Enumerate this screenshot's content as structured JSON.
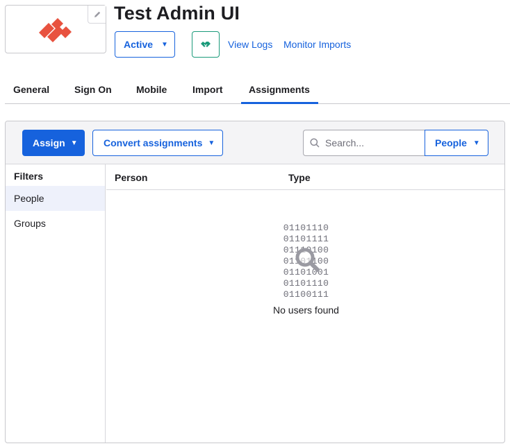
{
  "header": {
    "title": "Test Admin UI",
    "logo_icon": "paloalto-logo-icon",
    "edit_icon": "pencil-icon",
    "status_label": "Active",
    "status_caret": "▼",
    "handshake_icon": "handshake-icon",
    "links": [
      "View Logs",
      "Monitor Imports"
    ]
  },
  "tabs": [
    {
      "label": "General"
    },
    {
      "label": "Sign On"
    },
    {
      "label": "Mobile"
    },
    {
      "label": "Import"
    },
    {
      "label": "Assignments",
      "active": true
    }
  ],
  "toolbar": {
    "assign_label": "Assign",
    "convert_label": "Convert assignments",
    "caret": "▼",
    "search_placeholder": "Search...",
    "people_label": "People"
  },
  "filters": {
    "title": "Filters",
    "items": [
      {
        "label": "People",
        "active": true
      },
      {
        "label": "Groups"
      }
    ]
  },
  "table": {
    "columns": [
      "Person",
      "Type"
    ],
    "empty_art": [
      "01101110",
      "01101111",
      "01110100",
      "01101100",
      "01101001",
      "01101110",
      "01100111"
    ],
    "empty_message": "No users found"
  },
  "colors": {
    "accent": "#1662dd",
    "logo": "#e8523f",
    "handshake": "#1a9a7a"
  }
}
